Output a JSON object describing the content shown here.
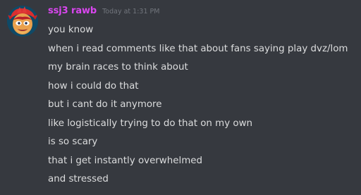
{
  "author": {
    "username": "ssj3 rawb",
    "timestamp": "Today at 1:31 PM",
    "avatar_icon": "cartoon-avatar-icon",
    "name_color": "#d946ef"
  },
  "messages": [
    "you know",
    "when i read comments like that about fans saying play dvz/lom",
    "my brain races to think about",
    "how i could do that",
    "but i cant do it anymore",
    "like logistically trying to do that on my own",
    "is so scary",
    "that i get instantly overwhelmed",
    "and stressed"
  ],
  "theme": {
    "background": "#36393f",
    "text": "#dcddde",
    "muted": "#72767d"
  }
}
